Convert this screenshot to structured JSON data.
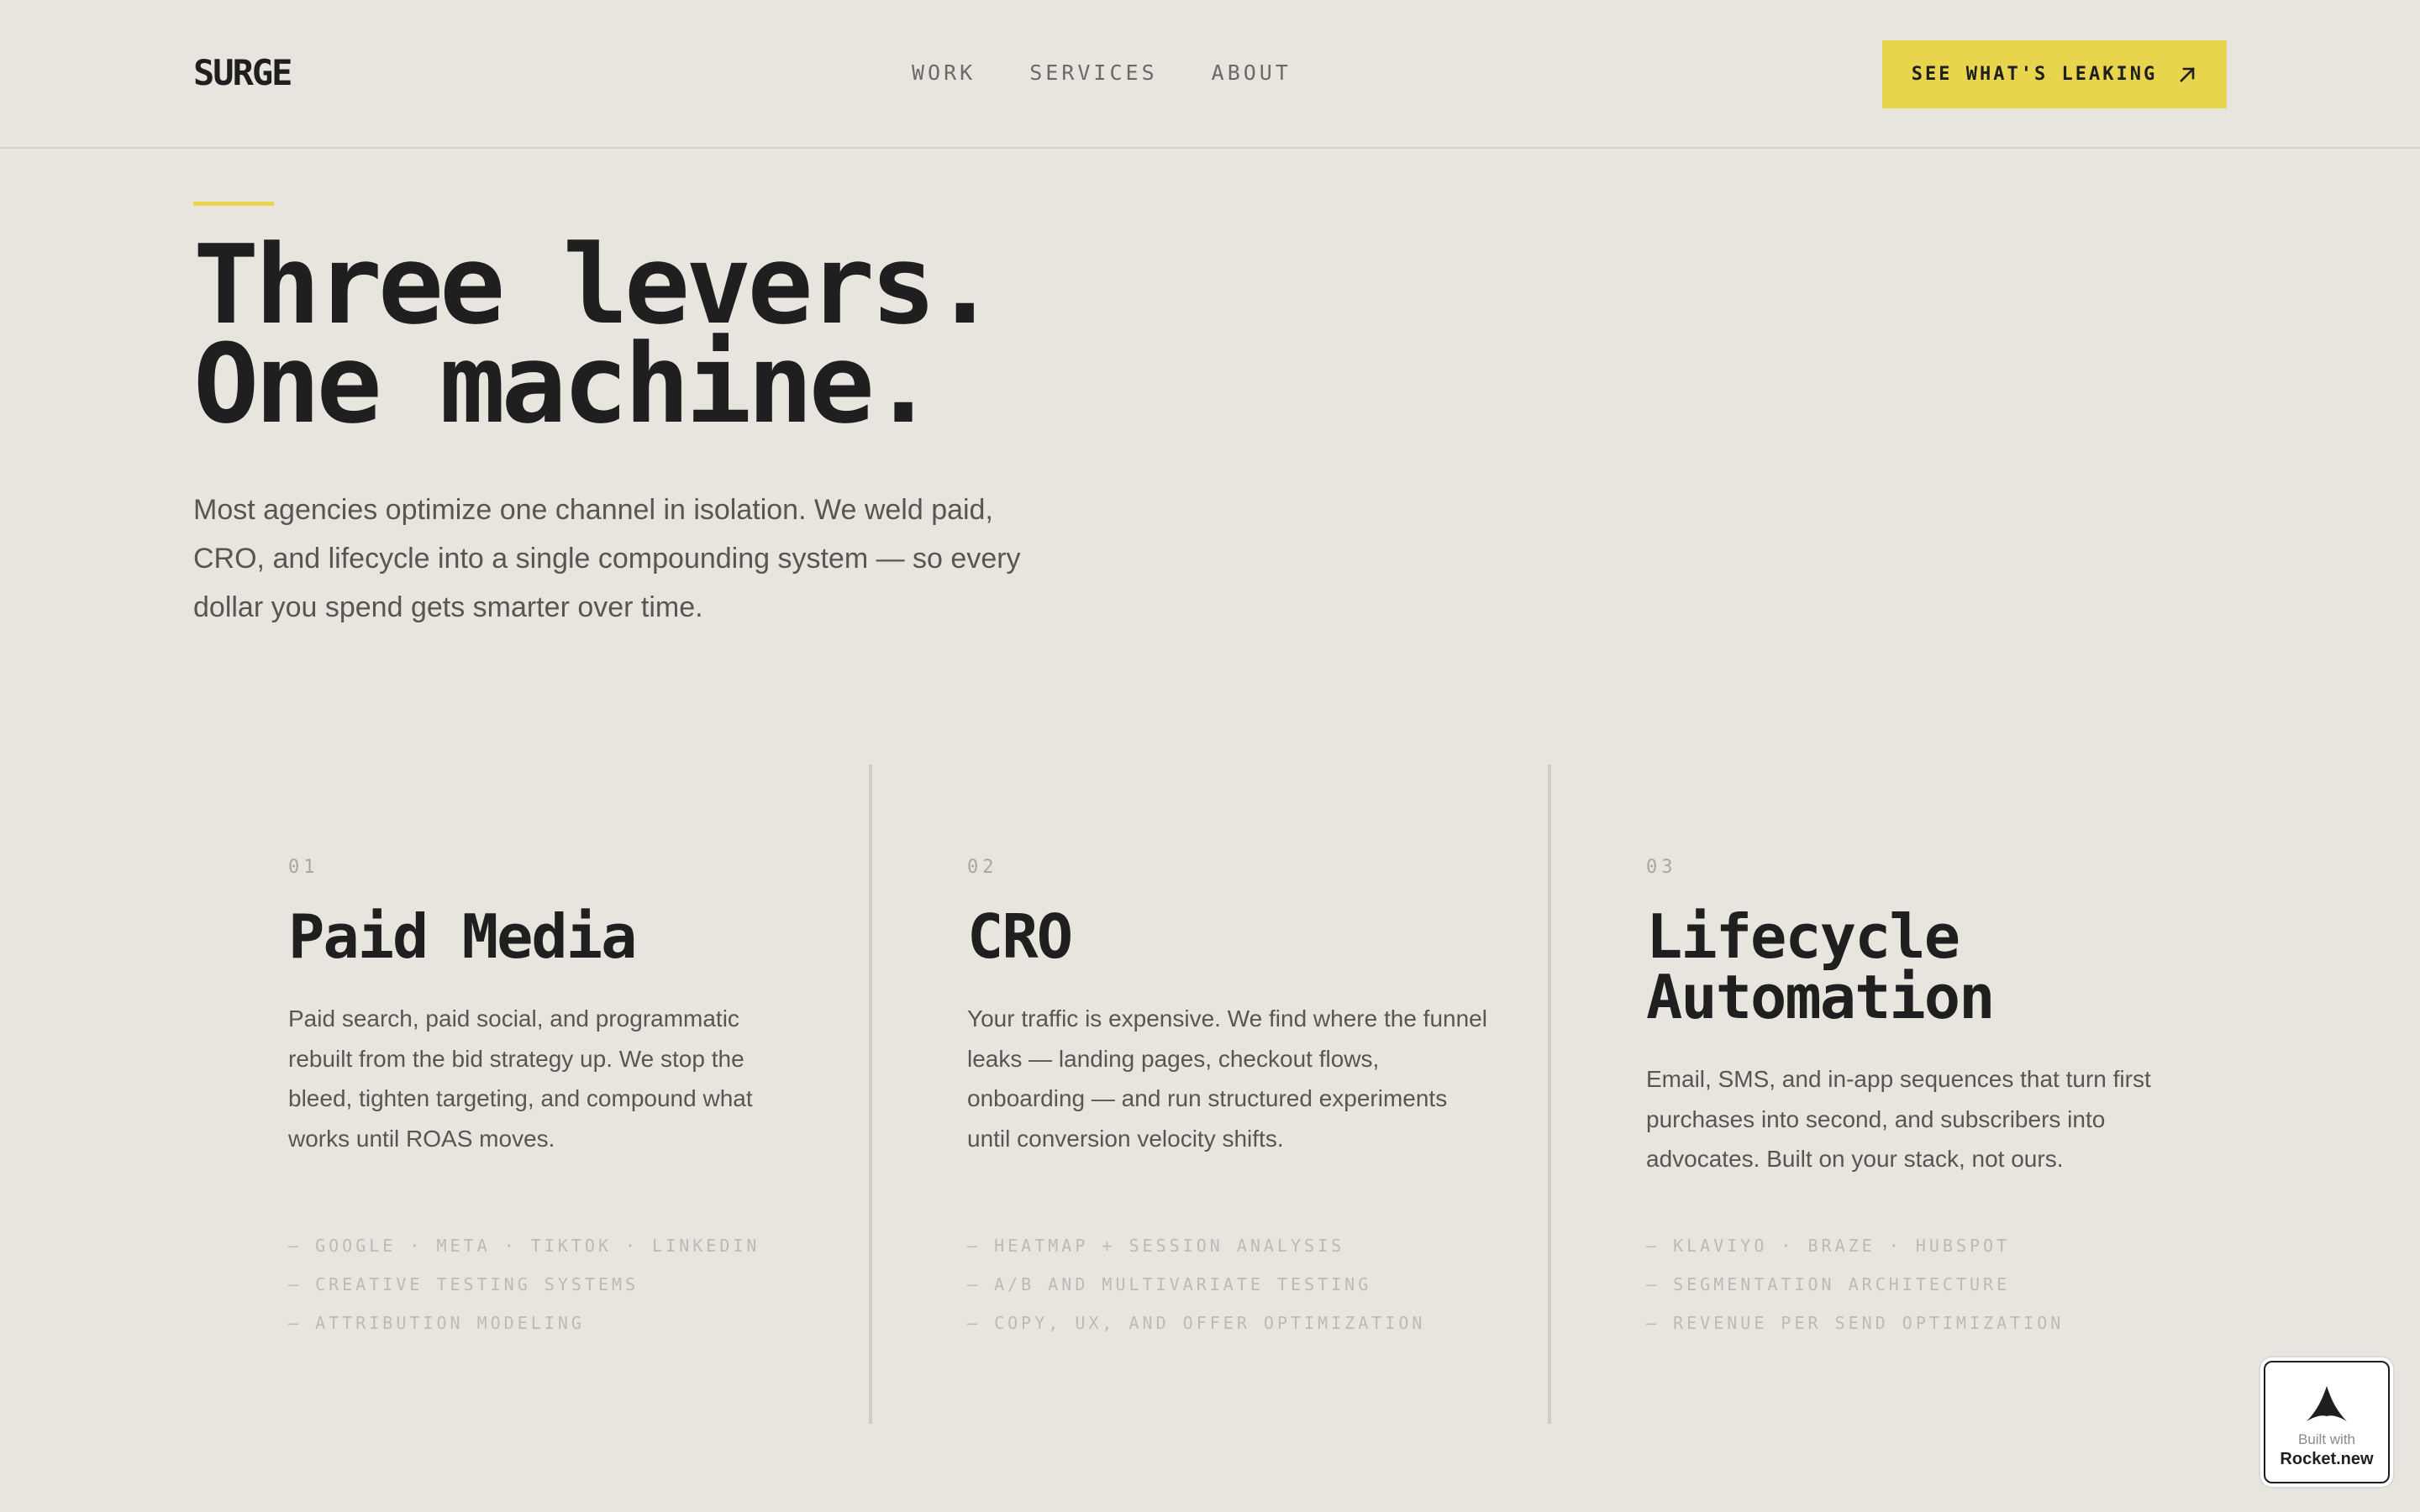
{
  "header": {
    "logo": "SURGE",
    "nav": [
      "WORK",
      "SERVICES",
      "ABOUT"
    ],
    "cta_label": "SEE WHAT'S LEAKING",
    "cta_icon": "arrow-up-right-icon"
  },
  "hero": {
    "title_line1": "Three levers.",
    "title_line2": "One machine.",
    "subtitle": "Most agencies optimize one channel in isolation. We weld paid, CRO, and lifecycle into a single compounding system — so every dollar you spend gets smarter over time."
  },
  "columns": [
    {
      "number": "01",
      "title_lines": [
        "Paid Media"
      ],
      "body": "Paid search, paid social, and programmatic rebuilt from the bid strategy up. We stop the bleed, tighten targeting, and compound what works until ROAS moves.",
      "tags": [
        "— GOOGLE · META · TIKTOK · LINKEDIN",
        "— CREATIVE TESTING SYSTEMS",
        "— ATTRIBUTION MODELING"
      ]
    },
    {
      "number": "02",
      "title_lines": [
        "CRO"
      ],
      "body": "Your traffic is expensive. We find where the funnel leaks — landing pages, checkout flows, onboarding — and run structured experiments until conversion velocity shifts.",
      "tags": [
        "— HEATMAP + SESSION ANALYSIS",
        "— A/B AND MULTIVARIATE TESTING",
        "— COPY, UX, AND OFFER OPTIMIZATION"
      ]
    },
    {
      "number": "03",
      "title_lines": [
        "Lifecycle",
        "Automation"
      ],
      "body": "Email, SMS, and in-app sequences that turn first purchases into second, and subscribers into advocates. Built on your stack, not ours.",
      "tags": [
        "— KLAVIYO · BRAZE · HUBSPOT",
        "— SEGMENTATION ARCHITECTURE",
        "— REVENUE PER SEND OPTIMIZATION"
      ]
    }
  ],
  "badge": {
    "line1": "Built with",
    "line2": "Rocket.new",
    "icon": "rocket-icon"
  },
  "colors": {
    "background": "#e8e5df",
    "accent": "#e8d44d",
    "text": "#1f1f1f"
  }
}
